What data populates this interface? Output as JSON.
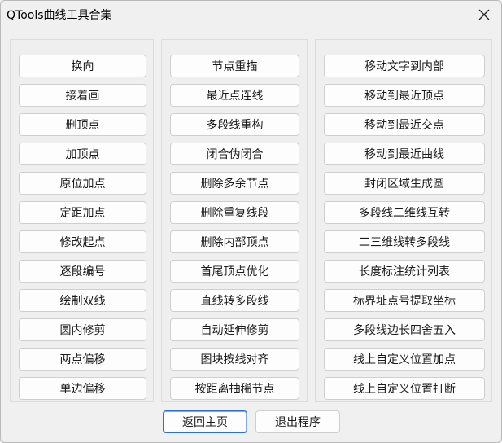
{
  "window": {
    "title": "QTools曲线工具合集",
    "close_symbol": "✕"
  },
  "columns": [
    [
      "换向",
      "接着画",
      "删顶点",
      "加顶点",
      "原位加点",
      "定距加点",
      "修改起点",
      "逐段编号",
      "绘制双线",
      "圆内修剪",
      "两点偏移",
      "单边偏移"
    ],
    [
      "节点重描",
      "最近点连线",
      "多段线重构",
      "闭合伪闭合",
      "删除多余节点",
      "删除重复线段",
      "删除内部顶点",
      "首尾顶点优化",
      "直线转多段线",
      "自动延伸修剪",
      "图块按线对齐",
      "按距离抽稀节点"
    ],
    [
      "移动文字到内部",
      "移动到最近顶点",
      "移动到最近交点",
      "移动到最近曲线",
      "封闭区域生成圆",
      "多段线二维线互转",
      "二三维线转多段线",
      "长度标注统计列表",
      "标界址点号提取坐标",
      "多段线边长四舍五入",
      "线上自定义位置加点",
      "线上自定义位置打断"
    ]
  ],
  "footer": {
    "home_label": "返回主页",
    "exit_label": "退出程序"
  }
}
